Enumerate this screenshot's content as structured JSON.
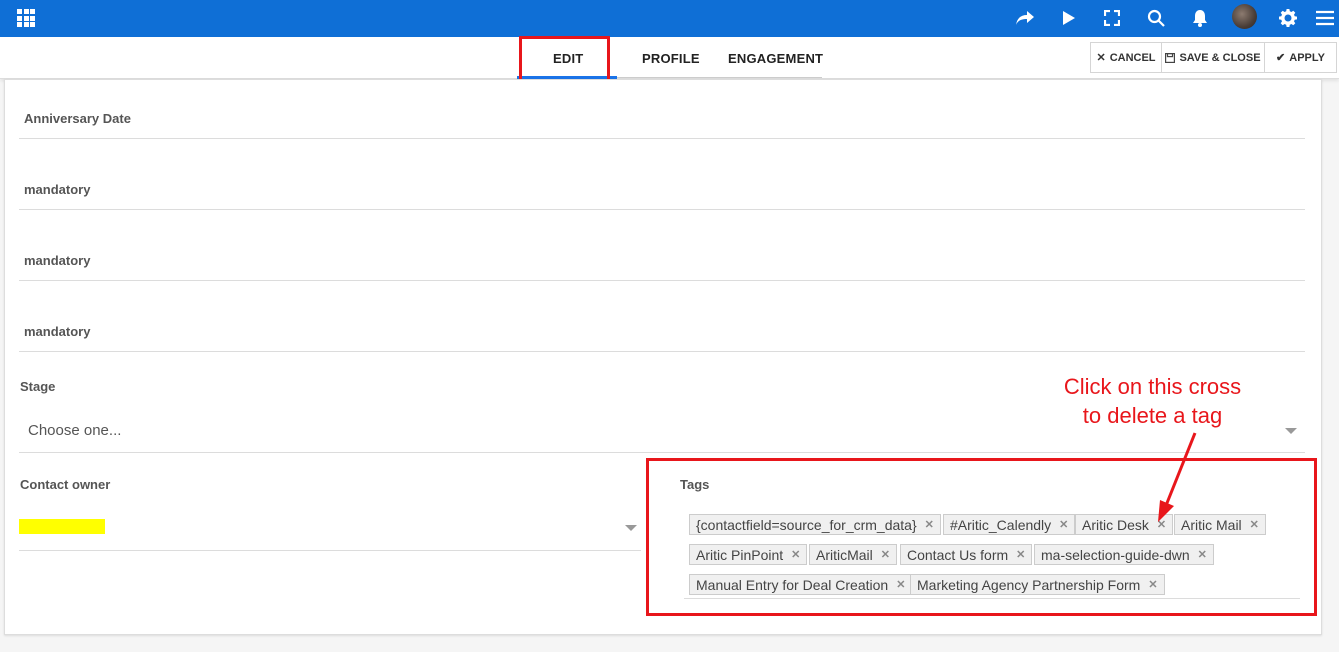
{
  "topbar": {
    "color": "#0f6fd6",
    "icons": [
      "apps-grid-icon",
      "share-icon",
      "play-icon",
      "fullscreen-icon",
      "search-icon",
      "bell-icon",
      "avatar",
      "gear-icon",
      "menu-icon"
    ]
  },
  "tabs": [
    {
      "label": "EDIT",
      "active": true
    },
    {
      "label": "PROFILE",
      "active": false
    },
    {
      "label": "ENGAGEMENT",
      "active": false
    }
  ],
  "actions": {
    "cancel": "CANCEL",
    "save_close": "SAVE & CLOSE",
    "apply": "APPLY"
  },
  "form": {
    "anniversary_label": "Anniversary Date",
    "mandatory_1": "mandatory",
    "mandatory_2": "mandatory",
    "mandatory_3": "mandatory",
    "stage_label": "Stage",
    "stage_value": "Choose one...",
    "owner_label": "Contact owner",
    "tags_label": "Tags"
  },
  "tags": [
    "{contactfield=source_for_crm_data}",
    "#Aritic_Calendly",
    "Aritic Desk",
    "Aritic Mail",
    "Aritic PinPoint",
    "AriticMail",
    "Contact Us form",
    "ma-selection-guide-dwn",
    "Manual Entry for Deal Creation",
    "Marketing Agency Partnership Form"
  ],
  "annotation": {
    "line1": "Click on this cross",
    "line2": "to delete a tag",
    "color": "#e8161b"
  }
}
